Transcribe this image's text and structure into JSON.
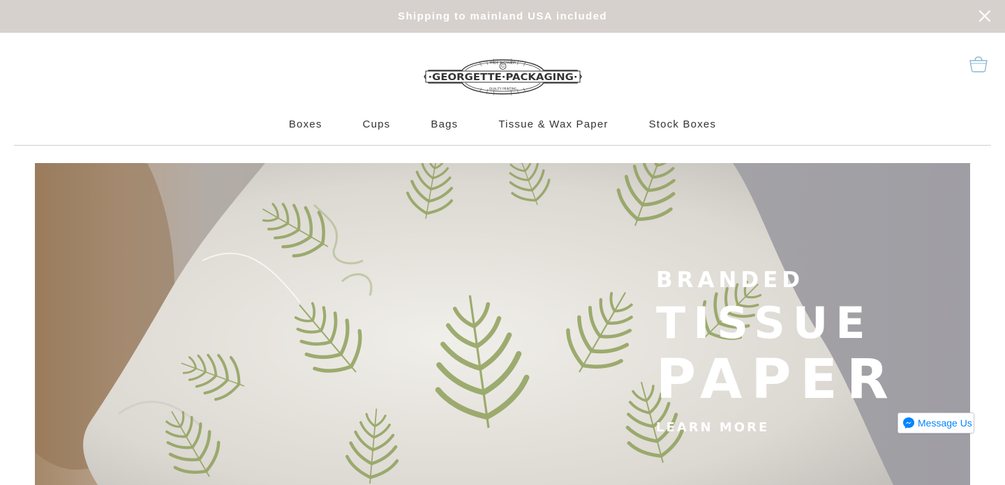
{
  "announcement": {
    "text": "Shipping to mainland USA included",
    "close_icon": "close-icon"
  },
  "header": {
    "logo": {
      "text_main": "·GEORGETTE·PACKAGING·",
      "text_top": "MADE IN CANADA",
      "text_bottom": "QUALITY PRINTING",
      "monogram": "G"
    },
    "cart_icon": "shopping-bag-icon",
    "nav": [
      {
        "label": "Boxes"
      },
      {
        "label": "Cups"
      },
      {
        "label": "Bags"
      },
      {
        "label": "Tissue & Wax Paper"
      },
      {
        "label": "Stock Boxes"
      }
    ]
  },
  "hero": {
    "line1": "BRANDED",
    "line2": "TISSUE",
    "line3": "PAPER",
    "cta": "LEARN MORE"
  },
  "messenger": {
    "label": "Message Us",
    "icon": "messenger-icon",
    "color": "#0084ff"
  },
  "colors": {
    "announcement_bg": "#d7d1cd",
    "cart_icon": "#8bb9d3",
    "fern_green": "#8ea05a"
  }
}
